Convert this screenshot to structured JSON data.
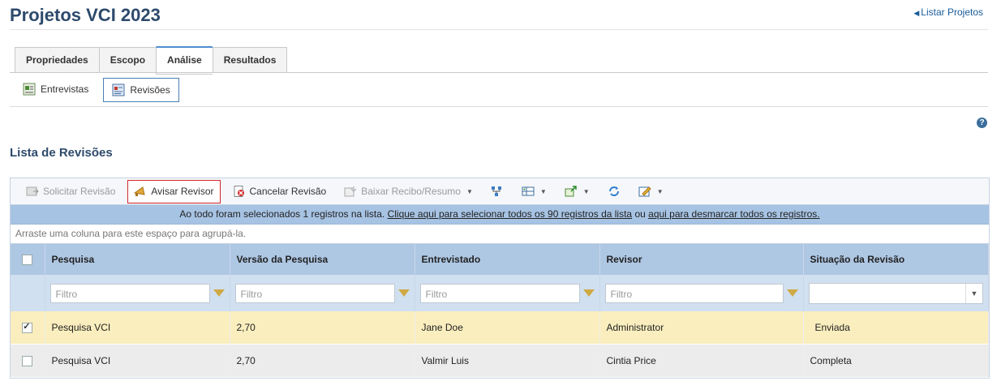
{
  "page": {
    "title": "Projetos VCI 2023",
    "back_link": "Listar Projetos"
  },
  "tabs": [
    {
      "label": "Propriedades",
      "active": false
    },
    {
      "label": "Escopo",
      "active": false
    },
    {
      "label": "Análise",
      "active": true
    },
    {
      "label": "Resultados",
      "active": false
    }
  ],
  "subtabs": [
    {
      "label": "Entrevistas",
      "icon": "interview-icon",
      "active": false
    },
    {
      "label": "Revisões",
      "icon": "review-icon",
      "active": true
    }
  ],
  "section_title": "Lista de Revisões",
  "toolbar": {
    "request_review": "Solicitar Revisão",
    "notify_reviewer": "Avisar Revisor",
    "cancel_review": "Cancelar Revisão",
    "download_receipt": "Baixar Recibo/Resumo"
  },
  "info_bar": {
    "prefix": "Ao todo foram selecionados 1 registros na lista.",
    "select_all_link": "Clique aqui para selecionar todos os 90 registros da lista",
    "middle": "ou",
    "deselect_link": "aqui para desmarcar todos os registros."
  },
  "group_hint": "Arraste uma coluna para este espaço para agrupá-la.",
  "columns": [
    "Pesquisa",
    "Versão da Pesquisa",
    "Entrevistado",
    "Revisor",
    "Situação da Revisão"
  ],
  "filter_placeholder": "Filtro",
  "rows": [
    {
      "checked": true,
      "pesquisa": "Pesquisa VCI",
      "versao": "2,70",
      "entrevistado": "Jane Doe",
      "revisor": "Administrator",
      "situacao": "Enviada"
    },
    {
      "checked": false,
      "pesquisa": "Pesquisa VCI",
      "versao": "2,70",
      "entrevistado": "Valmir Luis",
      "revisor": "Cintia Price",
      "situacao": "Completa"
    }
  ],
  "colors": {
    "accent": "#2d4a6c",
    "header": "#aec7e3",
    "info_bar": "#a7c3e3",
    "selected_row": "#faeebe",
    "highlight_border": "#d0282c"
  }
}
